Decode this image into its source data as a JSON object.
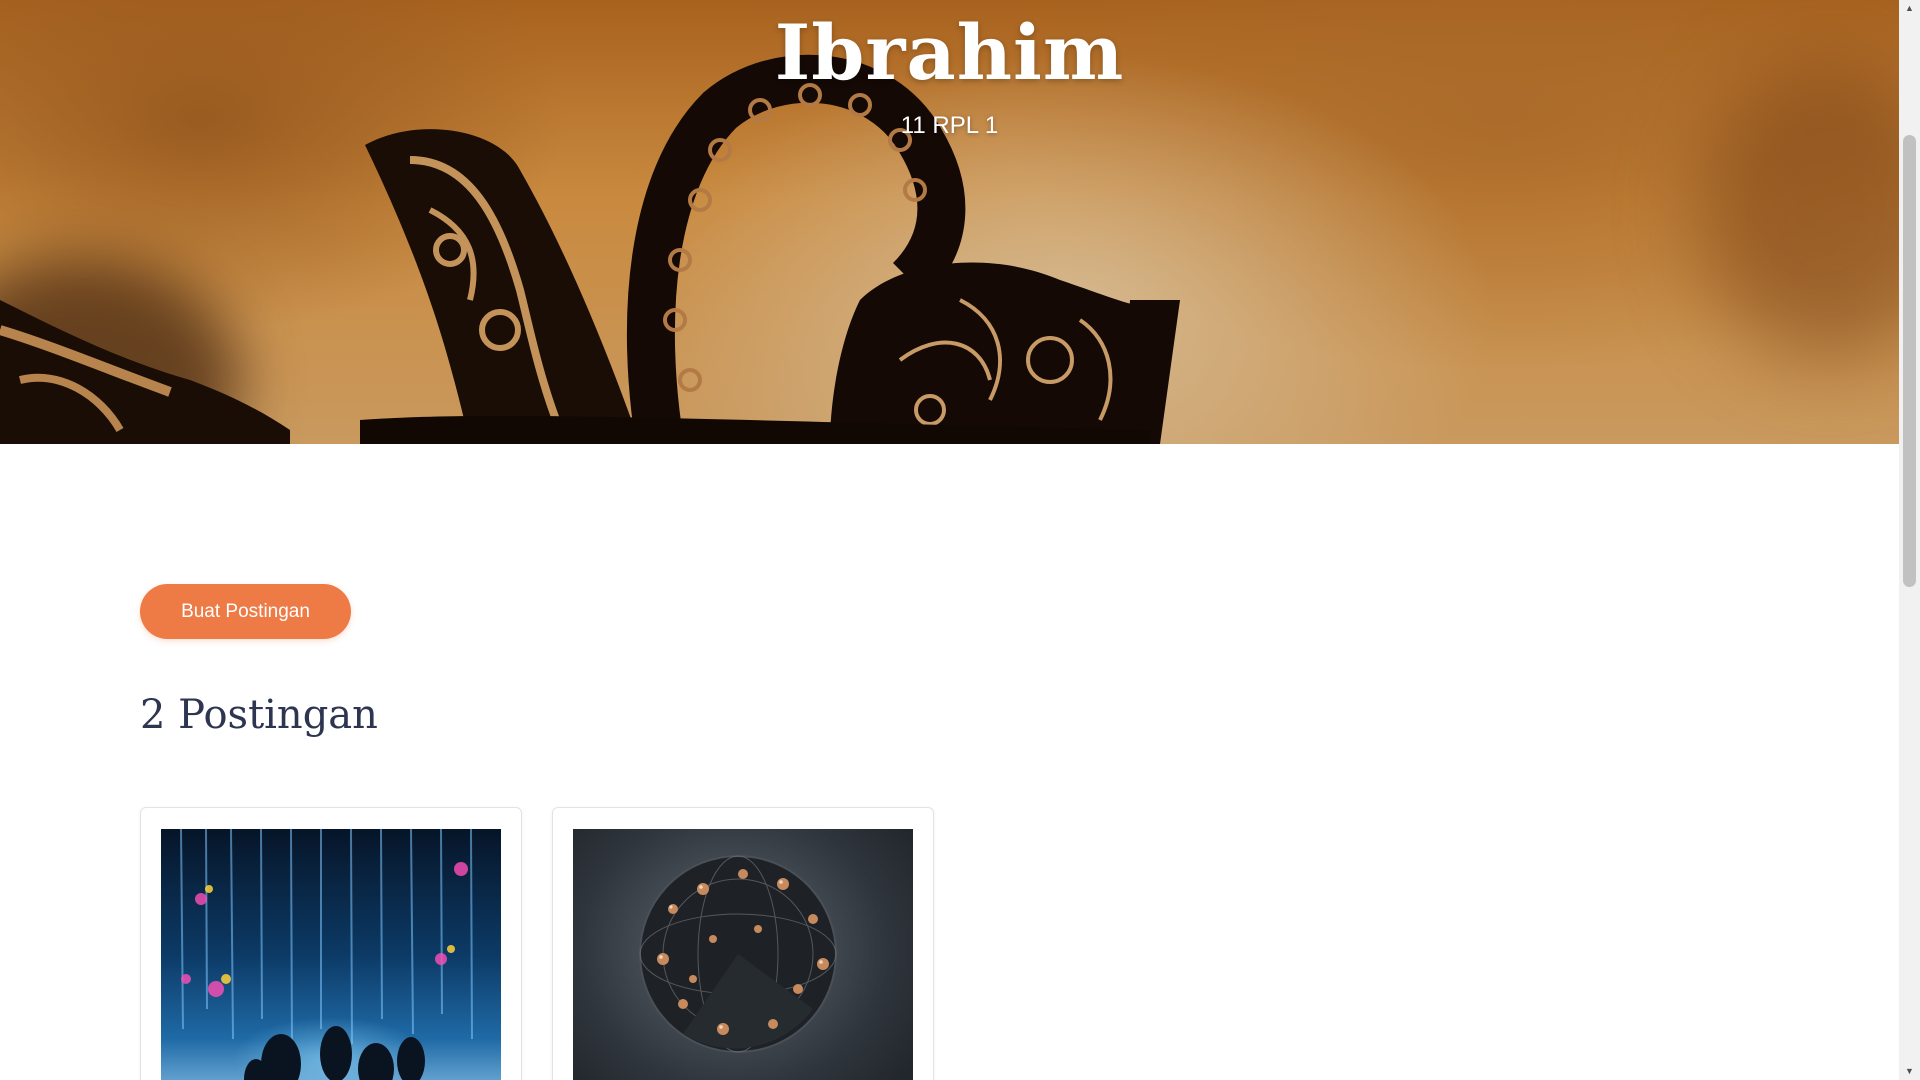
{
  "hero": {
    "title": "Ibrahim",
    "subtitle": "11 RPL 1"
  },
  "actions": {
    "create_post_label": "Buat Postingan"
  },
  "posts_section": {
    "title": "2 Postingan",
    "posts": [
      {
        "image": "immersive-light-forest-image"
      },
      {
        "image": "abstract-metal-sphere-image"
      }
    ]
  },
  "scrollbar": {
    "up_icon": "▲",
    "down_icon": "▼"
  },
  "colors": {
    "accent": "#ee7a45",
    "heading": "#2d3550",
    "hero_tone": "#c98a3f"
  }
}
